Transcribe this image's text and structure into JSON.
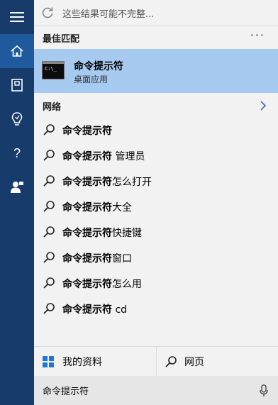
{
  "notice": {
    "text": "这些结果可能不完整..."
  },
  "sections": {
    "best_match": "最佳匹配",
    "web": "网络"
  },
  "best_match": {
    "title": "命令提示符",
    "subtitle": "桌面应用",
    "icon_prompt": "C:\\_"
  },
  "suggestions": [
    {
      "bold": "命令提示符",
      "rest": ""
    },
    {
      "bold": "命令提示符",
      "rest": " 管理员"
    },
    {
      "bold": "命令提示符",
      "rest": "怎么打开"
    },
    {
      "bold": "命令提示符",
      "rest": "大全"
    },
    {
      "bold": "命令提示符",
      "rest": "快捷键"
    },
    {
      "bold": "命令提示符",
      "rest": "窗口"
    },
    {
      "bold": "命令提示符",
      "rest": "怎么用"
    },
    {
      "bold": "命令提示符",
      "rest": " cd"
    }
  ],
  "scopes": {
    "my_stuff": "我的资料",
    "web": "网页"
  },
  "search": {
    "query": "命令提示符"
  },
  "rail": {
    "items": [
      "hamburger-icon",
      "home-icon",
      "notebook-icon",
      "lightbulb-icon",
      "help-icon",
      "feedback-icon"
    ]
  },
  "colors": {
    "rail": "#173c6b",
    "rail_active": "#1e5a9c",
    "highlight": "#a7cbf0",
    "panel": "#f2f2f2"
  }
}
